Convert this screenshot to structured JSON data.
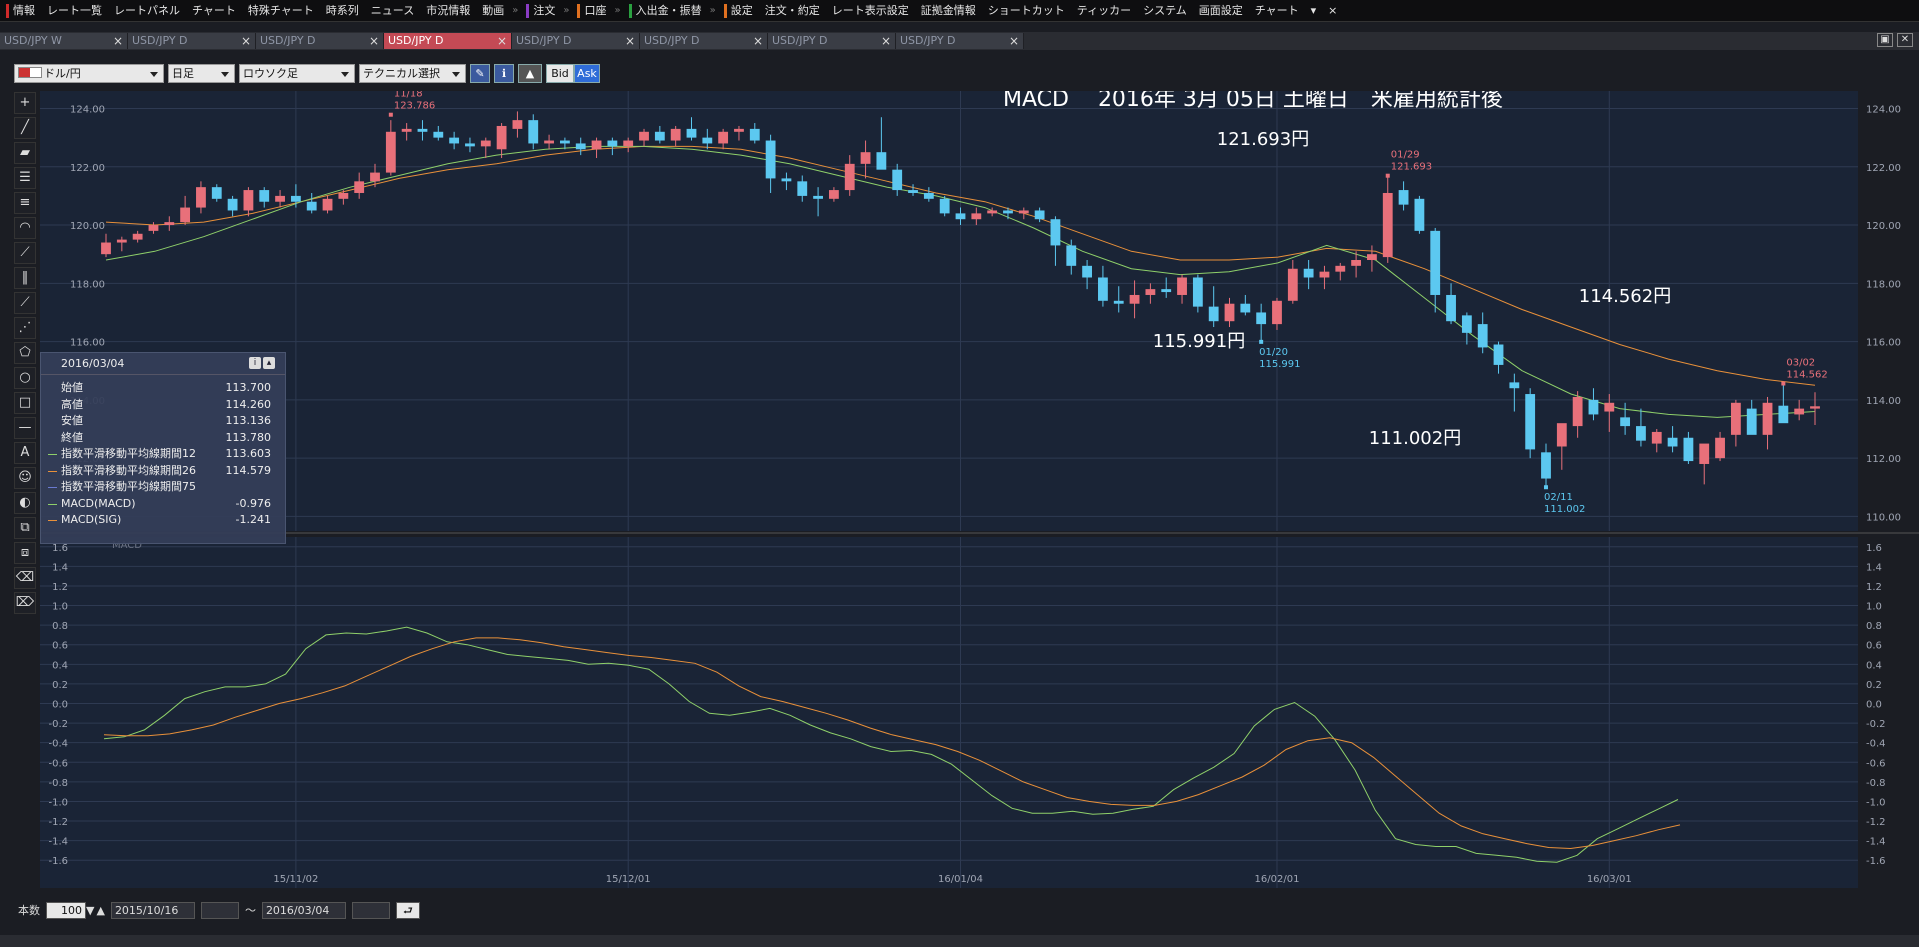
{
  "menu": {
    "items": [
      {
        "label": "情報",
        "mark": "#d02a2a"
      },
      {
        "label": "レート一覧"
      },
      {
        "label": "レートパネル"
      },
      {
        "label": "チャート"
      },
      {
        "label": "特殊チャート"
      },
      {
        "label": "時系列"
      },
      {
        "label": "ニュース"
      },
      {
        "label": "市況情報"
      },
      {
        "label": "動画"
      },
      {
        "label": "注文",
        "mark": "#8a3cc4"
      },
      {
        "label": "口座",
        "mark": "#e07020"
      },
      {
        "label": "入出金・振替",
        "mark": "#2aa040"
      },
      {
        "label": "設定",
        "mark": "#e07020"
      },
      {
        "label": "注文・約定"
      },
      {
        "label": "レート表示設定"
      },
      {
        "label": "証拠金情報"
      },
      {
        "label": "ショートカット"
      },
      {
        "label": "ティッカー"
      },
      {
        "label": "システム"
      },
      {
        "label": "画面設定"
      },
      {
        "label": "チャート"
      }
    ],
    "more_icon": "▾",
    "close_icon": "×"
  },
  "tabs": [
    {
      "label": "USD/JPY W",
      "active": false
    },
    {
      "label": "USD/JPY D",
      "active": false
    },
    {
      "label": "USD/JPY D",
      "active": false
    },
    {
      "label": "USD/JPY D",
      "active": true
    },
    {
      "label": "USD/JPY D",
      "active": false
    },
    {
      "label": "USD/JPY D",
      "active": false
    },
    {
      "label": "USD/JPY D",
      "active": false
    },
    {
      "label": "USD/JPY D",
      "active": false
    }
  ],
  "toolbar": {
    "pair": "ドル/円",
    "period": "日足",
    "chart_type": "ロウソク足",
    "technical": "テクニカル選択",
    "bid": "Bid",
    "ask": "Ask"
  },
  "annotations": {
    "title": "MACD　 2016年 3月 05日 土曜日　米雇用統計後",
    "high1": "121.693円",
    "low1": "115.991円",
    "low2": "111.002円",
    "high2": "114.562円",
    "mark_1118_date": "11/18",
    "mark_1118_val": "123.786",
    "mark_0129_date": "01/29",
    "mark_0129_val": "121.693",
    "mark_0120_date": "01/20",
    "mark_0120_val": "115.991",
    "mark_0211_date": "02/11",
    "mark_0211_val": "111.002",
    "mark_0302_date": "03/02",
    "mark_0302_val": "114.562"
  },
  "info_panel": {
    "date": "2016/03/04",
    "rows": [
      {
        "label": "始値",
        "value": "113.700"
      },
      {
        "label": "高値",
        "value": "114.260"
      },
      {
        "label": "安値",
        "value": "113.136"
      },
      {
        "label": "終値",
        "value": "113.780"
      },
      {
        "label": "指数平滑移動平均線期間12",
        "value": "113.603",
        "color": "#8fd06a"
      },
      {
        "label": "指数平滑移動平均線期間26",
        "value": "114.579",
        "color": "#e8903a"
      },
      {
        "label": "指数平滑移動平均線期間75",
        "value": "",
        "color": "#6a7ad0"
      },
      {
        "label": "MACD(MACD)",
        "value": "-0.976",
        "color": "#8fd06a"
      },
      {
        "label": "MACD(SIG)",
        "value": "-1.241",
        "color": "#e8903a"
      }
    ]
  },
  "bottom": {
    "count_label": "本数",
    "count_value": "100",
    "from": "2015/10/16",
    "tilde": "～",
    "to": "2016/03/04"
  },
  "colors": {
    "bull": "#e8707a",
    "bear": "#5cc8f0",
    "ema12": "#8fd06a",
    "ema26": "#e8903a",
    "bg": "#1a2436"
  },
  "chart_data": [
    {
      "type": "candlestick",
      "title": "",
      "ylim": [
        109.5,
        124.6
      ],
      "y_ticks": [
        "124.00",
        "122.00",
        "120.00",
        "118.00",
        "116.00",
        "114.00",
        "112.00",
        "110.00"
      ],
      "x_ticks": [
        "15/11/02",
        "15/12/01",
        "16/01/04",
        "16/02/01",
        "16/03/01"
      ],
      "series": [
        {
          "name": "指数平滑移動平均線期間12"
        },
        {
          "name": "指数平滑移動平均線期間26"
        }
      ],
      "ohlc": [
        [
          119.0,
          119.7,
          118.9,
          119.4
        ],
        [
          119.4,
          119.6,
          119.1,
          119.5
        ],
        [
          119.5,
          119.8,
          119.4,
          119.7
        ],
        [
          119.8,
          120.1,
          119.7,
          120.0
        ],
        [
          120.0,
          120.3,
          119.8,
          120.1
        ],
        [
          120.1,
          121.0,
          120.0,
          120.6
        ],
        [
          120.6,
          121.5,
          120.4,
          121.3
        ],
        [
          121.3,
          121.4,
          120.8,
          120.9
        ],
        [
          120.9,
          121.0,
          120.3,
          120.5
        ],
        [
          120.5,
          121.3,
          120.3,
          121.2
        ],
        [
          121.2,
          121.3,
          120.6,
          120.8
        ],
        [
          120.8,
          121.2,
          120.6,
          121.0
        ],
        [
          121.0,
          121.4,
          120.6,
          120.8
        ],
        [
          120.8,
          121.1,
          120.4,
          120.5
        ],
        [
          120.5,
          121.0,
          120.4,
          120.9
        ],
        [
          120.9,
          121.2,
          120.7,
          121.1
        ],
        [
          121.1,
          121.8,
          120.9,
          121.5
        ],
        [
          121.5,
          122.1,
          121.3,
          121.8
        ],
        [
          121.8,
          123.6,
          121.7,
          123.2
        ],
        [
          123.2,
          123.5,
          122.9,
          123.3
        ],
        [
          123.3,
          123.6,
          122.9,
          123.2
        ],
        [
          123.2,
          123.4,
          122.9,
          123.0
        ],
        [
          123.0,
          123.2,
          122.6,
          122.8
        ],
        [
          122.8,
          123.0,
          122.5,
          122.7
        ],
        [
          122.7,
          123.0,
          122.3,
          122.9
        ],
        [
          122.6,
          123.5,
          122.3,
          123.4
        ],
        [
          123.3,
          123.9,
          123.0,
          123.6
        ],
        [
          123.6,
          123.8,
          122.6,
          122.8
        ],
        [
          122.8,
          123.1,
          122.6,
          122.9
        ],
        [
          122.9,
          123.0,
          122.6,
          122.8
        ],
        [
          122.8,
          123.0,
          122.4,
          122.6
        ],
        [
          122.6,
          123.0,
          122.3,
          122.9
        ],
        [
          122.9,
          123.0,
          122.4,
          122.7
        ],
        [
          122.7,
          123.0,
          122.5,
          122.9
        ],
        [
          122.9,
          123.3,
          122.7,
          123.2
        ],
        [
          123.2,
          123.4,
          122.8,
          122.9
        ],
        [
          122.9,
          123.4,
          122.7,
          123.3
        ],
        [
          123.3,
          123.7,
          122.9,
          123.0
        ],
        [
          123.0,
          123.3,
          122.6,
          122.8
        ],
        [
          122.8,
          123.3,
          122.6,
          123.2
        ],
        [
          123.2,
          123.4,
          122.9,
          123.3
        ],
        [
          123.3,
          123.5,
          122.8,
          122.9
        ],
        [
          122.9,
          123.1,
          121.1,
          121.6
        ],
        [
          121.6,
          121.8,
          121.2,
          121.5
        ],
        [
          121.5,
          121.7,
          120.8,
          121.0
        ],
        [
          121.0,
          121.3,
          120.3,
          120.9
        ],
        [
          120.9,
          121.3,
          120.8,
          121.2
        ],
        [
          121.2,
          122.4,
          121.0,
          122.1
        ],
        [
          122.1,
          122.9,
          121.6,
          122.5
        ],
        [
          122.5,
          123.7,
          122.2,
          121.9
        ],
        [
          121.9,
          122.1,
          121.0,
          121.2
        ],
        [
          121.2,
          121.4,
          121.0,
          121.1
        ],
        [
          121.1,
          121.3,
          120.8,
          120.9
        ],
        [
          120.9,
          121.0,
          120.3,
          120.4
        ],
        [
          120.4,
          120.6,
          120.0,
          120.2
        ],
        [
          120.2,
          120.6,
          120.0,
          120.4
        ],
        [
          120.4,
          120.6,
          120.3,
          120.5
        ],
        [
          120.5,
          120.6,
          120.2,
          120.4
        ],
        [
          120.4,
          120.6,
          120.2,
          120.5
        ],
        [
          120.5,
          120.6,
          120.1,
          120.2
        ],
        [
          120.2,
          120.3,
          118.6,
          119.3
        ],
        [
          119.3,
          119.5,
          118.3,
          118.6
        ],
        [
          118.6,
          118.8,
          117.8,
          118.2
        ],
        [
          118.2,
          118.6,
          117.2,
          117.4
        ],
        [
          117.4,
          117.9,
          117.0,
          117.3
        ],
        [
          117.3,
          118.1,
          116.8,
          117.6
        ],
        [
          117.6,
          118.0,
          117.3,
          117.8
        ],
        [
          117.8,
          118.2,
          117.5,
          117.7
        ],
        [
          117.6,
          118.3,
          117.3,
          118.2
        ],
        [
          118.2,
          118.3,
          117.0,
          117.2
        ],
        [
          117.2,
          117.9,
          116.5,
          116.7
        ],
        [
          116.7,
          117.5,
          116.5,
          117.3
        ],
        [
          117.3,
          117.6,
          116.9,
          117.0
        ],
        [
          117.0,
          117.3,
          115.99,
          116.6
        ],
        [
          116.6,
          117.5,
          116.4,
          117.4
        ],
        [
          117.4,
          118.8,
          117.3,
          118.5
        ],
        [
          118.5,
          118.8,
          117.8,
          118.2
        ],
        [
          118.2,
          118.6,
          117.8,
          118.4
        ],
        [
          118.4,
          118.7,
          118.1,
          118.6
        ],
        [
          118.6,
          119.1,
          118.2,
          118.8
        ],
        [
          118.8,
          119.3,
          118.4,
          119.0
        ],
        [
          118.9,
          121.693,
          118.7,
          121.1
        ],
        [
          121.2,
          121.5,
          120.5,
          120.7
        ],
        [
          120.9,
          121.0,
          119.7,
          119.8
        ],
        [
          119.8,
          119.9,
          117.0,
          117.6
        ],
        [
          117.6,
          118.0,
          116.6,
          116.7
        ],
        [
          116.9,
          117.0,
          115.9,
          116.3
        ],
        [
          116.6,
          117.0,
          115.6,
          115.8
        ],
        [
          115.9,
          116.0,
          114.9,
          115.2
        ],
        [
          114.6,
          114.9,
          113.6,
          114.4
        ],
        [
          114.2,
          114.4,
          112.0,
          112.3
        ],
        [
          112.2,
          112.5,
          111.002,
          111.3
        ],
        [
          112.4,
          112.7,
          111.6,
          113.2
        ],
        [
          113.1,
          114.3,
          112.7,
          114.1
        ],
        [
          114.0,
          114.4,
          113.3,
          113.5
        ],
        [
          113.6,
          114.2,
          112.9,
          113.9
        ],
        [
          113.4,
          113.9,
          112.8,
          113.1
        ],
        [
          113.1,
          113.7,
          112.4,
          112.6
        ],
        [
          112.5,
          113.0,
          112.2,
          112.9
        ],
        [
          112.7,
          113.1,
          112.2,
          112.4
        ],
        [
          112.7,
          112.9,
          111.8,
          111.9
        ],
        [
          111.8,
          112.2,
          111.1,
          112.5
        ],
        [
          112.0,
          112.9,
          111.9,
          112.7
        ],
        [
          112.8,
          114.0,
          112.4,
          113.9
        ],
        [
          113.7,
          114.0,
          112.9,
          112.8
        ],
        [
          112.8,
          114.1,
          112.3,
          113.9
        ],
        [
          113.8,
          114.562,
          113.5,
          113.2
        ],
        [
          113.5,
          114.0,
          113.3,
          113.7
        ],
        [
          113.7,
          114.26,
          113.136,
          113.78
        ]
      ],
      "ema12": [
        118.8,
        119.1,
        119.6,
        120.2,
        120.8,
        121.3,
        121.7,
        122.1,
        122.4,
        122.6,
        122.7,
        122.7,
        122.6,
        122.4,
        122.1,
        121.7,
        121.3,
        121.0,
        120.6,
        119.9,
        119.1,
        118.5,
        118.3,
        118.4,
        118.7,
        119.3,
        118.8,
        117.5,
        116.2,
        115.0,
        114.2,
        113.7,
        113.5,
        113.4,
        113.5,
        113.6
      ],
      "ema26": [
        120.1,
        120.0,
        120.1,
        120.4,
        120.8,
        121.2,
        121.6,
        121.9,
        122.1,
        122.4,
        122.6,
        122.7,
        122.7,
        122.6,
        122.3,
        121.9,
        121.5,
        121.1,
        120.8,
        120.3,
        119.7,
        119.1,
        118.8,
        118.8,
        118.9,
        119.2,
        119.1,
        118.5,
        117.8,
        117.1,
        116.5,
        115.9,
        115.4,
        115.0,
        114.7,
        114.5
      ]
    },
    {
      "type": "line",
      "title": "",
      "panel_label": "MACD",
      "ylim": [
        -1.7,
        1.7
      ],
      "y_ticks": [
        "1.6",
        "1.4",
        "1.2",
        "1.0",
        "0.8",
        "0.6",
        "0.4",
        "0.2",
        "0.0",
        "-0.2",
        "-0.4",
        "-0.6",
        "-0.8",
        "-1.0",
        "-1.2",
        "-1.4",
        "-1.6"
      ],
      "series": [
        {
          "name": "MACD(MACD)",
          "values": [
            -0.36,
            -0.34,
            -0.27,
            -0.12,
            0.05,
            0.12,
            0.17,
            0.17,
            0.2,
            0.3,
            0.56,
            0.7,
            0.72,
            0.71,
            0.74,
            0.78,
            0.72,
            0.63,
            0.6,
            0.55,
            0.5,
            0.48,
            0.46,
            0.44,
            0.4,
            0.41,
            0.39,
            0.35,
            0.2,
            0.02,
            -0.1,
            -0.12,
            -0.09,
            -0.05,
            -0.12,
            -0.22,
            -0.3,
            -0.36,
            -0.44,
            -0.49,
            -0.48,
            -0.52,
            -0.62,
            -0.78,
            -0.94,
            -1.07,
            -1.12,
            -1.12,
            -1.1,
            -1.13,
            -1.12,
            -1.08,
            -1.05,
            -0.88,
            -0.76,
            -0.65,
            -0.51,
            -0.23,
            -0.06,
            0.01,
            -0.13,
            -0.37,
            -0.68,
            -1.09,
            -1.38,
            -1.44,
            -1.46,
            -1.46,
            -1.53,
            -1.55,
            -1.57,
            -1.61,
            -1.62,
            -1.55,
            -1.38,
            -1.28,
            -1.18,
            -1.08,
            -0.98
          ]
        },
        {
          "name": "MACD(SIG)",
          "values": [
            -0.32,
            -0.33,
            -0.33,
            -0.31,
            -0.27,
            -0.22,
            -0.14,
            -0.07,
            0.0,
            0.05,
            0.11,
            0.18,
            0.28,
            0.38,
            0.48,
            0.56,
            0.63,
            0.67,
            0.67,
            0.65,
            0.62,
            0.58,
            0.55,
            0.52,
            0.49,
            0.47,
            0.44,
            0.41,
            0.32,
            0.18,
            0.07,
            0.02,
            -0.04,
            -0.1,
            -0.17,
            -0.25,
            -0.32,
            -0.37,
            -0.42,
            -0.49,
            -0.58,
            -0.69,
            -0.8,
            -0.88,
            -0.96,
            -1.0,
            -1.03,
            -1.04,
            -1.04,
            -1.0,
            -0.93,
            -0.84,
            -0.75,
            -0.63,
            -0.47,
            -0.38,
            -0.35,
            -0.4,
            -0.55,
            -0.74,
            -0.93,
            -1.12,
            -1.25,
            -1.33,
            -1.38,
            -1.43,
            -1.47,
            -1.48,
            -1.45,
            -1.4,
            -1.35,
            -1.29,
            -1.24
          ]
        }
      ]
    }
  ]
}
